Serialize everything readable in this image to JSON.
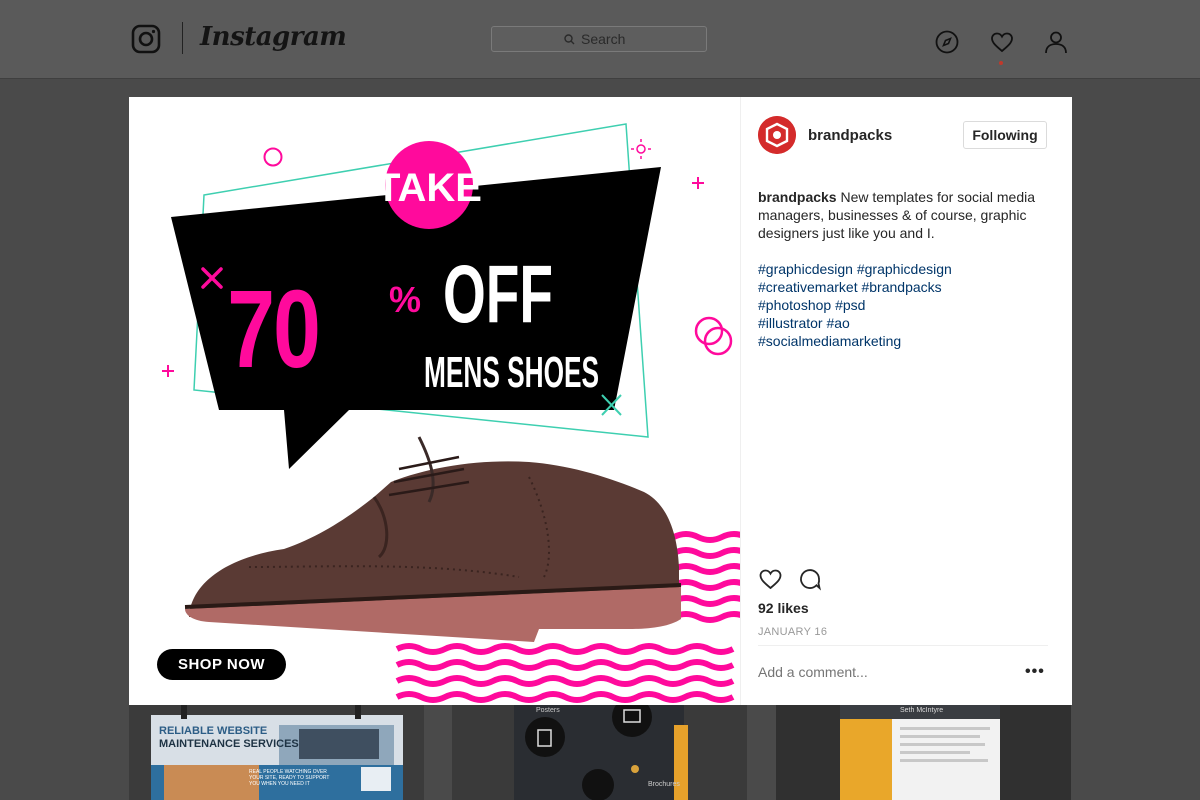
{
  "app": {
    "wordmark": "Instagram"
  },
  "search": {
    "placeholder": "Search"
  },
  "nav": {
    "icons": [
      "compass-icon",
      "heart-icon",
      "profile-icon"
    ]
  },
  "post": {
    "username": "brandpacks",
    "follow_label": "Following",
    "caption_user": "brandpacks",
    "caption_text": "New templates for social media managers, businesses & of course, graphic designers just like you and I.",
    "hashtags": [
      "#graphicdesign #graphicdesign",
      "#creativemarket #brandpacks",
      "#photoshop #psd",
      "#illustrator #ao",
      "#socialmediamarketing"
    ],
    "likes": "92 likes",
    "date": "JANUARY 16",
    "comment_placeholder": "Add a comment...",
    "more": "•••"
  },
  "ad": {
    "take": "TAKE",
    "percent_number": "70",
    "percent_sign": "%",
    "off": "OFF",
    "subtitle": "MENS SHOES",
    "button": "SHOP NOW"
  },
  "thumbnails": [
    {
      "title_line1": "RELIABLE WEBSITE",
      "title_line2": "MAINTENANCE SERVICES",
      "text": "REAL PEOPLE WATCHING OVER YOUR SITE, READY TO SUPPORT YOU WHEN YOU NEED IT"
    },
    {
      "label1": "Posters",
      "label2": "Brochures"
    },
    {
      "name": "Seth McIntyre"
    }
  ],
  "colors": {
    "accent_pink": "#ff0a9c",
    "teal_outline": "#3ecfb0",
    "link": "#003569",
    "avatar_red": "#d42b2b"
  }
}
